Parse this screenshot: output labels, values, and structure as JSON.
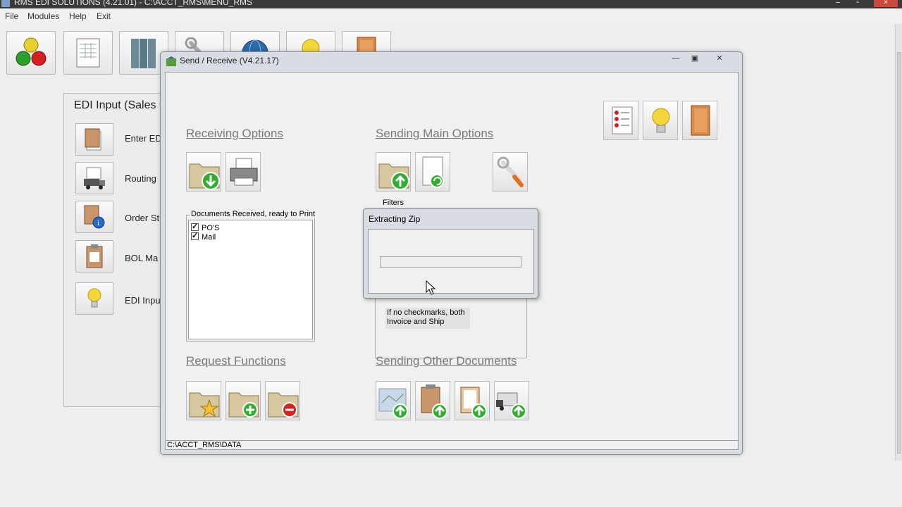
{
  "main_window": {
    "title": "RMS EDI SOLUTIONS  (4.21.01) - C:\\ACCT_RMS\\MENU_RMS",
    "controls": [
      "minimize",
      "maximize",
      "close"
    ]
  },
  "menu": [
    "File",
    "Modules",
    "Help",
    "Exit"
  ],
  "toolbar": {
    "icons": [
      "traffic-light-icon",
      "document-table-icon",
      "binders-icon",
      "wrench-icon",
      "globe-icon",
      "lightbulb-icon",
      "door-icon"
    ]
  },
  "background_panel": {
    "title": "EDI Input (Sales C",
    "items": [
      {
        "label": "Enter EDI",
        "icon": "document-icon"
      },
      {
        "label": "Routing",
        "icon": "truck-icon"
      },
      {
        "label": "Order St",
        "icon": "info-document-icon"
      },
      {
        "label": "BOL Ma",
        "icon": "clipboard-icon"
      },
      {
        "label": "EDI Input",
        "icon": "lightbulb-icon"
      }
    ]
  },
  "dialog": {
    "title": "Send / Receive (V4.21.17)",
    "controls": [
      "minimize",
      "restore",
      "close"
    ],
    "receiving_options": {
      "title": "Receiving Options"
    },
    "sending_main_options": {
      "title": "Sending Main Options"
    },
    "documents": {
      "legend": "Documents  Received, ready to Print",
      "items": [
        {
          "label": "PO'S",
          "checked": true
        },
        {
          "label": "Mail",
          "checked": true
        }
      ]
    },
    "filters_label": "Filters",
    "note": "If no checkmarks, both Invoice and Ship",
    "request_functions": {
      "title": "Request Functions"
    },
    "sending_other": {
      "title": "Sending Other Documents"
    },
    "status_path": "C:\\ACCT_RMS\\DATA"
  },
  "popup": {
    "title": "Extracting Zip",
    "progress": 0
  },
  "colors": {
    "accent_green": "#2fae2f",
    "section_title": "#7a7a7a",
    "dialog_frame": "#d8dde3"
  }
}
